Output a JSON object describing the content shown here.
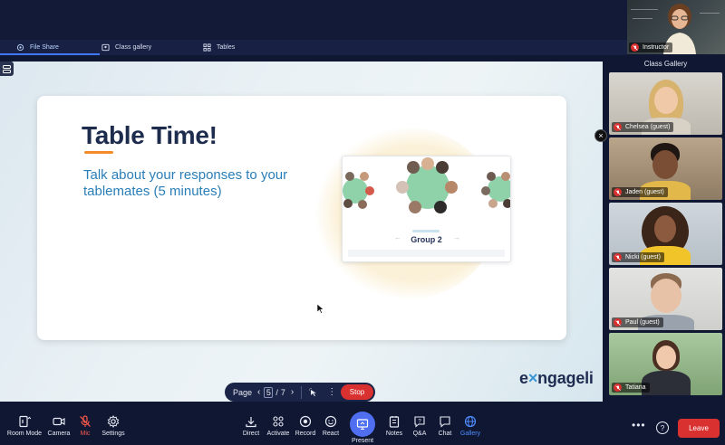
{
  "tabs": [
    {
      "label": "File Share",
      "icon": "file-share-icon",
      "active": true
    },
    {
      "label": "Class gallery",
      "icon": "class-gallery-icon",
      "active": false
    },
    {
      "label": "Tables",
      "icon": "tables-icon",
      "active": false
    }
  ],
  "instructor": {
    "label": "Instructor"
  },
  "slide": {
    "title": "Table Time!",
    "body": "Talk about your responses to your tablemates (5 minutes)",
    "thumbnail_label": "Group 2"
  },
  "brand": {
    "logo_prefix": "e",
    "logo_mid": "×",
    "logo_suffix": "ngageli"
  },
  "pager": {
    "label": "Page",
    "current": "5",
    "separator": "/",
    "total": "7",
    "stop_label": "Stop"
  },
  "gallery": {
    "title": "Class Gallery",
    "participants": [
      {
        "name": "Chelsea (guest)"
      },
      {
        "name": "Jaden (guest)"
      },
      {
        "name": "Nicki (guest)"
      },
      {
        "name": "Paul (guest)"
      },
      {
        "name": "Tatiana"
      }
    ]
  },
  "toolbar": {
    "room_mode": "Room Mode",
    "camera": "Camera",
    "mic": "Mic",
    "settings": "Settings",
    "direct": "Direct",
    "activate": "Activate",
    "record": "Record",
    "react": "React",
    "present": "Present",
    "notes": "Notes",
    "qa": "Q&A",
    "chat": "Chat",
    "gallery": "Gallery",
    "leave": "Leave"
  },
  "colors": {
    "accent": "#4f8cff",
    "danger": "#d93030",
    "title": "#1d2b4d",
    "body_text": "#2a7eb8",
    "underline": "#f28c28"
  }
}
